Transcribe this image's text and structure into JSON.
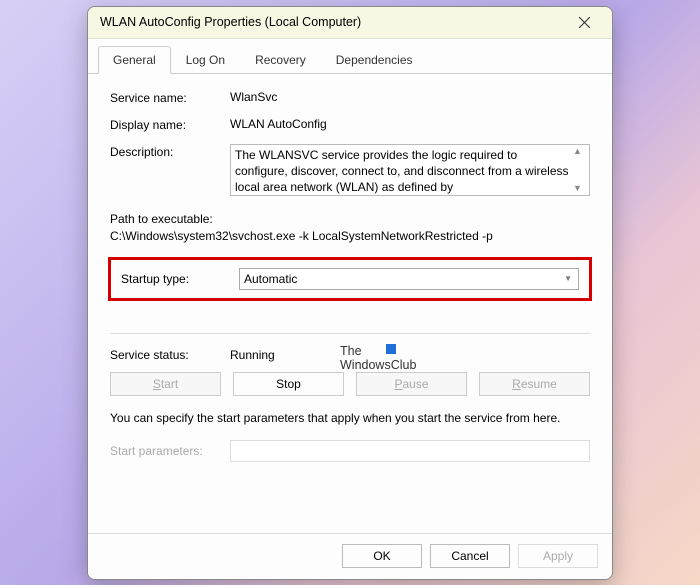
{
  "window": {
    "title": "WLAN AutoConfig Properties (Local Computer)"
  },
  "tabs": [
    {
      "label": "General",
      "active": true
    },
    {
      "label": "Log On",
      "active": false
    },
    {
      "label": "Recovery",
      "active": false
    },
    {
      "label": "Dependencies",
      "active": false
    }
  ],
  "general": {
    "service_name_label": "Service name:",
    "service_name_value": "WlanSvc",
    "display_name_label": "Display name:",
    "display_name_value": "WLAN AutoConfig",
    "description_label": "Description:",
    "description_value": "The WLANSVC service provides the logic required to configure, discover, connect to, and disconnect from a wireless local area network (WLAN) as defined by",
    "path_label": "Path to executable:",
    "path_value": "C:\\Windows\\system32\\svchost.exe -k LocalSystemNetworkRestricted -p",
    "startup_label": "Startup type:",
    "startup_value": "Automatic",
    "status_label": "Service status:",
    "status_value": "Running",
    "start_btn": "Start",
    "stop_btn": "Stop",
    "pause_btn": "Pause",
    "resume_btn": "Resume",
    "hint": "You can specify the start parameters that apply when you start the service from here.",
    "params_label": "Start parameters:",
    "params_value": ""
  },
  "footer": {
    "ok": "OK",
    "cancel": "Cancel",
    "apply": "Apply"
  },
  "watermark": {
    "line1": "The",
    "line2": "WindowsClub"
  }
}
